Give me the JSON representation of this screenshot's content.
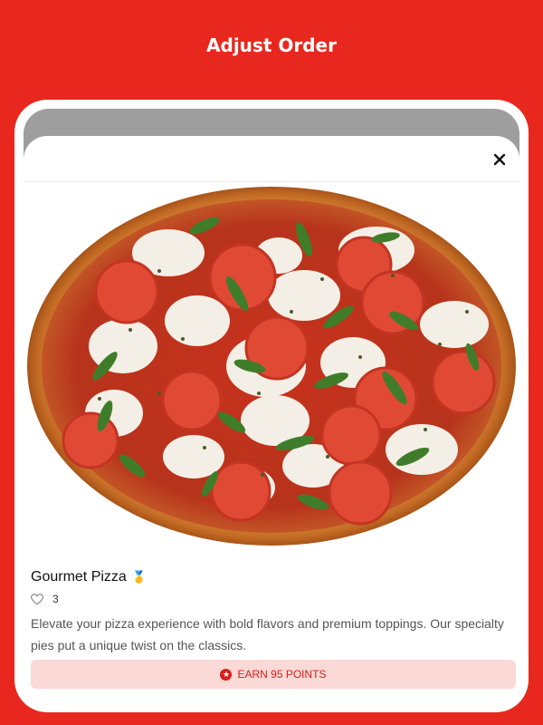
{
  "header": {
    "title": "Adjust Order"
  },
  "product": {
    "name": "Gourmet Pizza",
    "badge_emoji": "🥇",
    "likes": "3",
    "description": "Elevate your pizza experience with bold flavors and premium toppings. Our specialty pies put a unique twist on the classics.",
    "points_label": "EARN 95 POINTS"
  },
  "icons": {
    "close": "close-icon",
    "like": "heart-outline-icon",
    "points": "star-badge-icon"
  },
  "colors": {
    "brand": "#e8281f",
    "points_bg": "#fbd9d6",
    "points_text": "#d81f17"
  }
}
